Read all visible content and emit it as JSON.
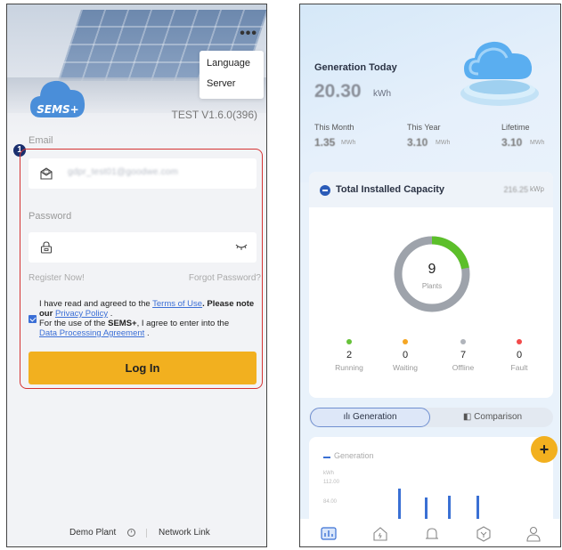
{
  "login": {
    "menu": {
      "language": "Language",
      "server": "Server"
    },
    "logo_text": "SEMS+",
    "version": "TEST  V1.6.0(396)",
    "step_number": "1",
    "email_label": "Email",
    "email_value": "gdpr_test01@goodwe.com",
    "password_label": "Password",
    "register_link": "Register Now!",
    "forgot_link": "Forgot Password?",
    "agreement": {
      "line1": "I have read and agreed to the",
      "terms": "Terms of Use",
      "line1_tail": ". Please note our",
      "privacy": "Privacy Policy",
      "line2_tail": ".",
      "line3_a": "For the use of the",
      "brand": "SEMS+",
      "line3_b": ", I agree to enter into the",
      "dpa": "Data Processing Agreement",
      "line4_tail": "."
    },
    "login_button": "Log In",
    "demo_plant": "Demo Plant",
    "network_link": "Network Link"
  },
  "dashboard": {
    "generation_today_label": "Generation Today",
    "generation_today_value": "20.30",
    "generation_today_unit": "kWh",
    "stats": [
      {
        "label": "This Month",
        "value": "1.35",
        "unit": "MWh"
      },
      {
        "label": "This Year",
        "value": "3.10",
        "unit": "MWh"
      },
      {
        "label": "Lifetime",
        "value": "3.10",
        "unit": "MWh"
      }
    ],
    "capacity_title": "Total Installed Capacity",
    "capacity_value": "216.25",
    "capacity_unit": "kWp",
    "plants_count": "9",
    "plants_label": "Plants",
    "running_fraction": 0.222,
    "status": [
      {
        "num": "2",
        "label": "Running",
        "color": "#67c23a"
      },
      {
        "num": "0",
        "label": "Waiting",
        "color": "#f5a623"
      },
      {
        "num": "7",
        "label": "Offline",
        "color": "#b0b4bb"
      },
      {
        "num": "0",
        "label": "Fault",
        "color": "#f24a4a"
      }
    ],
    "toggle_generation": "Generation",
    "toggle_comparison": "Comparison",
    "fab_label": "+",
    "chart_legend": "Generation",
    "chart_unit": "kWh",
    "chart_ticks": [
      "112.00",
      "84.00"
    ],
    "accent_yellow": "#f2b01f",
    "accent_blue": "#3a70d4"
  }
}
